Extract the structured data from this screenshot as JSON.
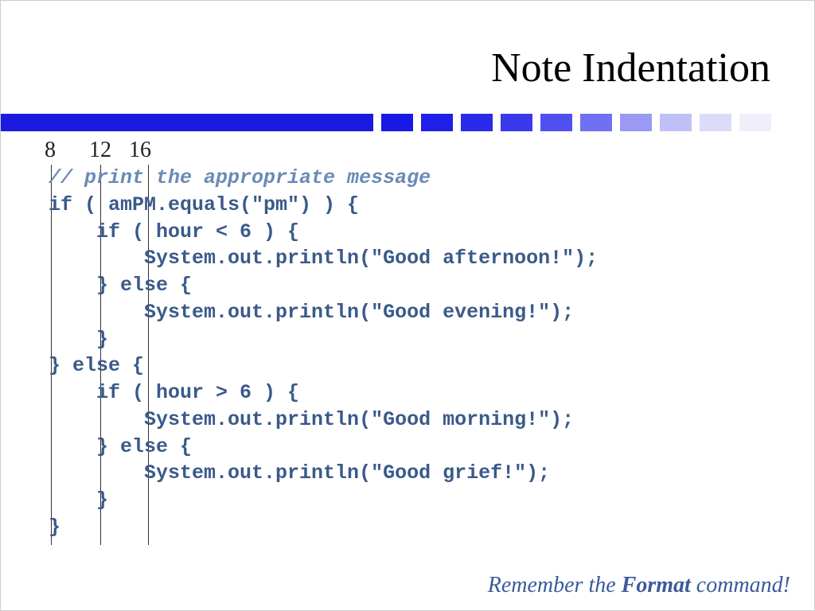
{
  "title": "Note Indentation",
  "ruler": {
    "col1": "8",
    "col2": "12",
    "col3": "16"
  },
  "bar_colors": [
    "#1919e6",
    "#1f1fe8",
    "#2a2aea",
    "#3a3aec",
    "#5050f0",
    "#7070f2",
    "#9a9af5",
    "#c0c0f7",
    "#dcdcfa",
    "#efeffc"
  ],
  "code": {
    "comment": "// print the appropriate message",
    "l1": "if ( amPM.equals(\"pm\") ) {",
    "l2": "    if ( hour < 6 ) {",
    "l3": "        System.out.println(\"Good afternoon!\");",
    "l4": "    } else {",
    "l5": "        System.out.println(\"Good evening!\");",
    "l6": "    }",
    "l7": "} else {",
    "l8": "    if ( hour > 6 ) {",
    "l9": "        System.out.println(\"Good morning!\");",
    "l10": "    } else {",
    "l11": "        System.out.println(\"Good grief!\");",
    "l12": "    }",
    "l13": "}"
  },
  "footer": {
    "pre": "Remember the ",
    "bold": "Format",
    "post": " command!"
  }
}
